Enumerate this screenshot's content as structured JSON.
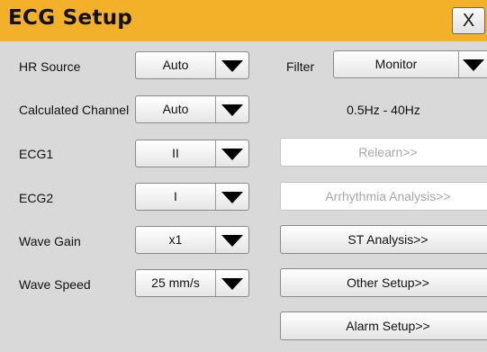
{
  "dialog": {
    "title": "ECG Setup",
    "close_label": "X"
  },
  "left": {
    "hr_source": {
      "label": "HR Source",
      "value": "Auto"
    },
    "calc_channel": {
      "label": "Calculated Channel",
      "value": "Auto"
    },
    "ecg1": {
      "label": "ECG1",
      "value": "II"
    },
    "ecg2": {
      "label": "ECG2",
      "value": "I"
    },
    "wave_gain": {
      "label": "Wave Gain",
      "value": "x1"
    },
    "wave_speed": {
      "label": "Wave Speed",
      "value": "25 mm/s"
    }
  },
  "right": {
    "filter": {
      "label": "Filter",
      "value": "Monitor"
    },
    "filter_range": "0.5Hz - 40Hz",
    "buttons": {
      "relearn": "Relearn>>",
      "arrhythmia": "Arrhythmia Analysis>>",
      "st_analysis": "ST Analysis>>",
      "other_setup": "Other Setup>>",
      "alarm_setup": "Alarm Setup>>"
    }
  },
  "colors": {
    "titlebar": "#f3b12a",
    "panel": "#d9d9d9",
    "disabled_text": "#a8a8a8"
  }
}
